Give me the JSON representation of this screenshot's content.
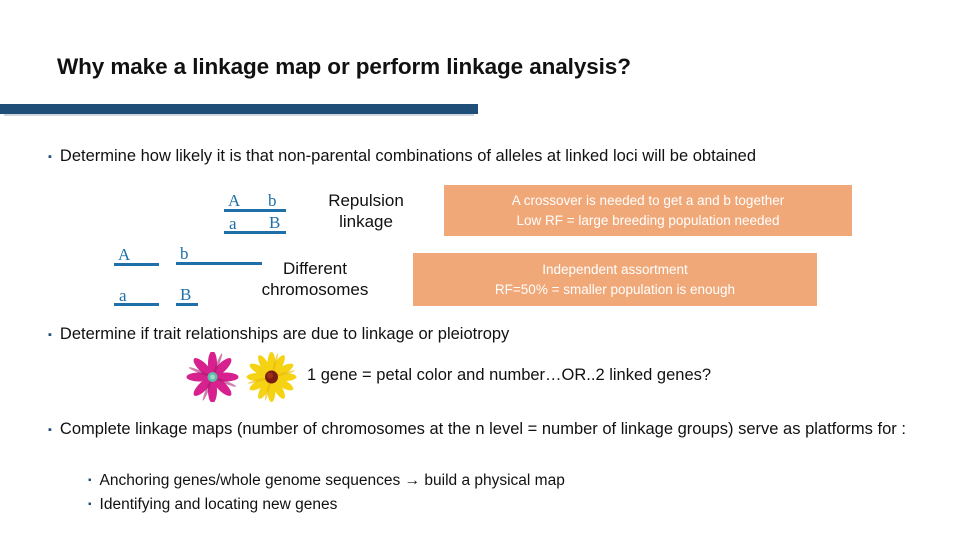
{
  "slide": {
    "title": "Why make a linkage map or perform linkage analysis?",
    "accent_color": "#1F4E79",
    "allele_color": "#1F6FA8",
    "callout_bg": "#F0A878",
    "callout_text_color": "#FFFFFF",
    "bullet_glyph": "▪"
  },
  "bullets": [
    {
      "id": "bullet-1",
      "level": 1,
      "text": "Determine how likely it is that non-parental combinations of alleles at linked loci will be obtained"
    },
    {
      "id": "bullet-2",
      "level": 1,
      "text": "Determine if trait relationships are due to linkage or pleiotropy"
    },
    {
      "id": "bullet-3",
      "level": 1,
      "text": "Complete linkage maps (number of chromosomes at the n level = number of linkage groups) serve as platforms for :"
    },
    {
      "id": "bullet-3a",
      "level": 2,
      "text": "Anchoring genes/whole genome sequences → build a physical map"
    },
    {
      "id": "bullet-3b",
      "level": 2,
      "text": "Identifying and locating new genes"
    }
  ],
  "diagram": {
    "repulsion": {
      "alleles_top": [
        "A",
        "b"
      ],
      "alleles_bottom": [
        "a",
        "B"
      ],
      "label": "Repulsion\nlinkage",
      "label_line1": "Repulsion",
      "label_line2": "linkage"
    },
    "different_chromosomes": {
      "alleles_top": [
        "A",
        "b"
      ],
      "alleles_bottom": [
        "a",
        "B"
      ],
      "label_line1": "Different",
      "label_line2": "chromosomes"
    }
  },
  "callouts": [
    {
      "id": "callout-1",
      "line1": "A crossover is needed to get a and b together",
      "line2": "Low RF = large breeding population needed"
    },
    {
      "id": "callout-2",
      "line1": "Independent assortment",
      "line2": "RF=50% = smaller population is enough"
    }
  ],
  "flowers": {
    "pink": {
      "name": "pink-flower",
      "petal_color": "#D6218F",
      "petal_color_dark": "#A8186E",
      "center_color": "#5BBFA8"
    },
    "yellow": {
      "name": "yellow-flower",
      "petal_color": "#F5D313",
      "petal_color_dark": "#E8B70C",
      "center_color": "#7A1E10"
    },
    "caption": "1 gene = petal color and number…OR..2 linked genes?"
  }
}
